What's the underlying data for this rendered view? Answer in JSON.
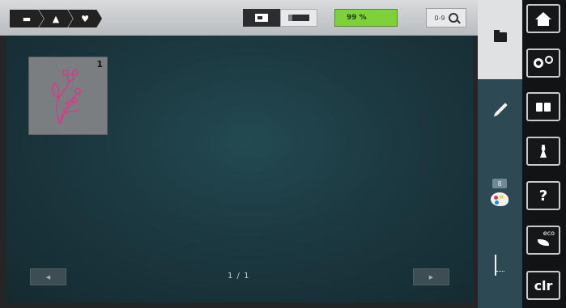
{
  "breadcrumb": {
    "items": [
      {
        "icon": "folder-icon",
        "glyph": "▬"
      },
      {
        "icon": "embroidery-folder-icon",
        "glyph": "▲"
      },
      {
        "icon": "heart-icon",
        "glyph": "♥"
      }
    ]
  },
  "topbar": {
    "mode_sewing_icon": "sewing-machine-icon",
    "mode_hoop_icon": "embroidery-hoop-icon",
    "progress_text": "99 %",
    "progress_value": 0.99,
    "zoom_label": "0-9"
  },
  "canvas": {
    "design": {
      "number": "1",
      "thread_color": "#e0338a"
    },
    "pager": {
      "label": "1 / 1",
      "prev_glyph": "◀",
      "next_glyph": "▶"
    }
  },
  "sidepanel": {
    "color_count": "8",
    "icons": [
      "folder-icon",
      "pencil-icon",
      "color-palette-icon",
      "needle-icon"
    ]
  },
  "systembar": {
    "help_label": "?",
    "eco_label": "eco",
    "clear_label": "clr"
  },
  "colors": {
    "progress_green": "#7fd13a",
    "canvas_teal": "#1c3840",
    "panel": "#2d4a54"
  }
}
